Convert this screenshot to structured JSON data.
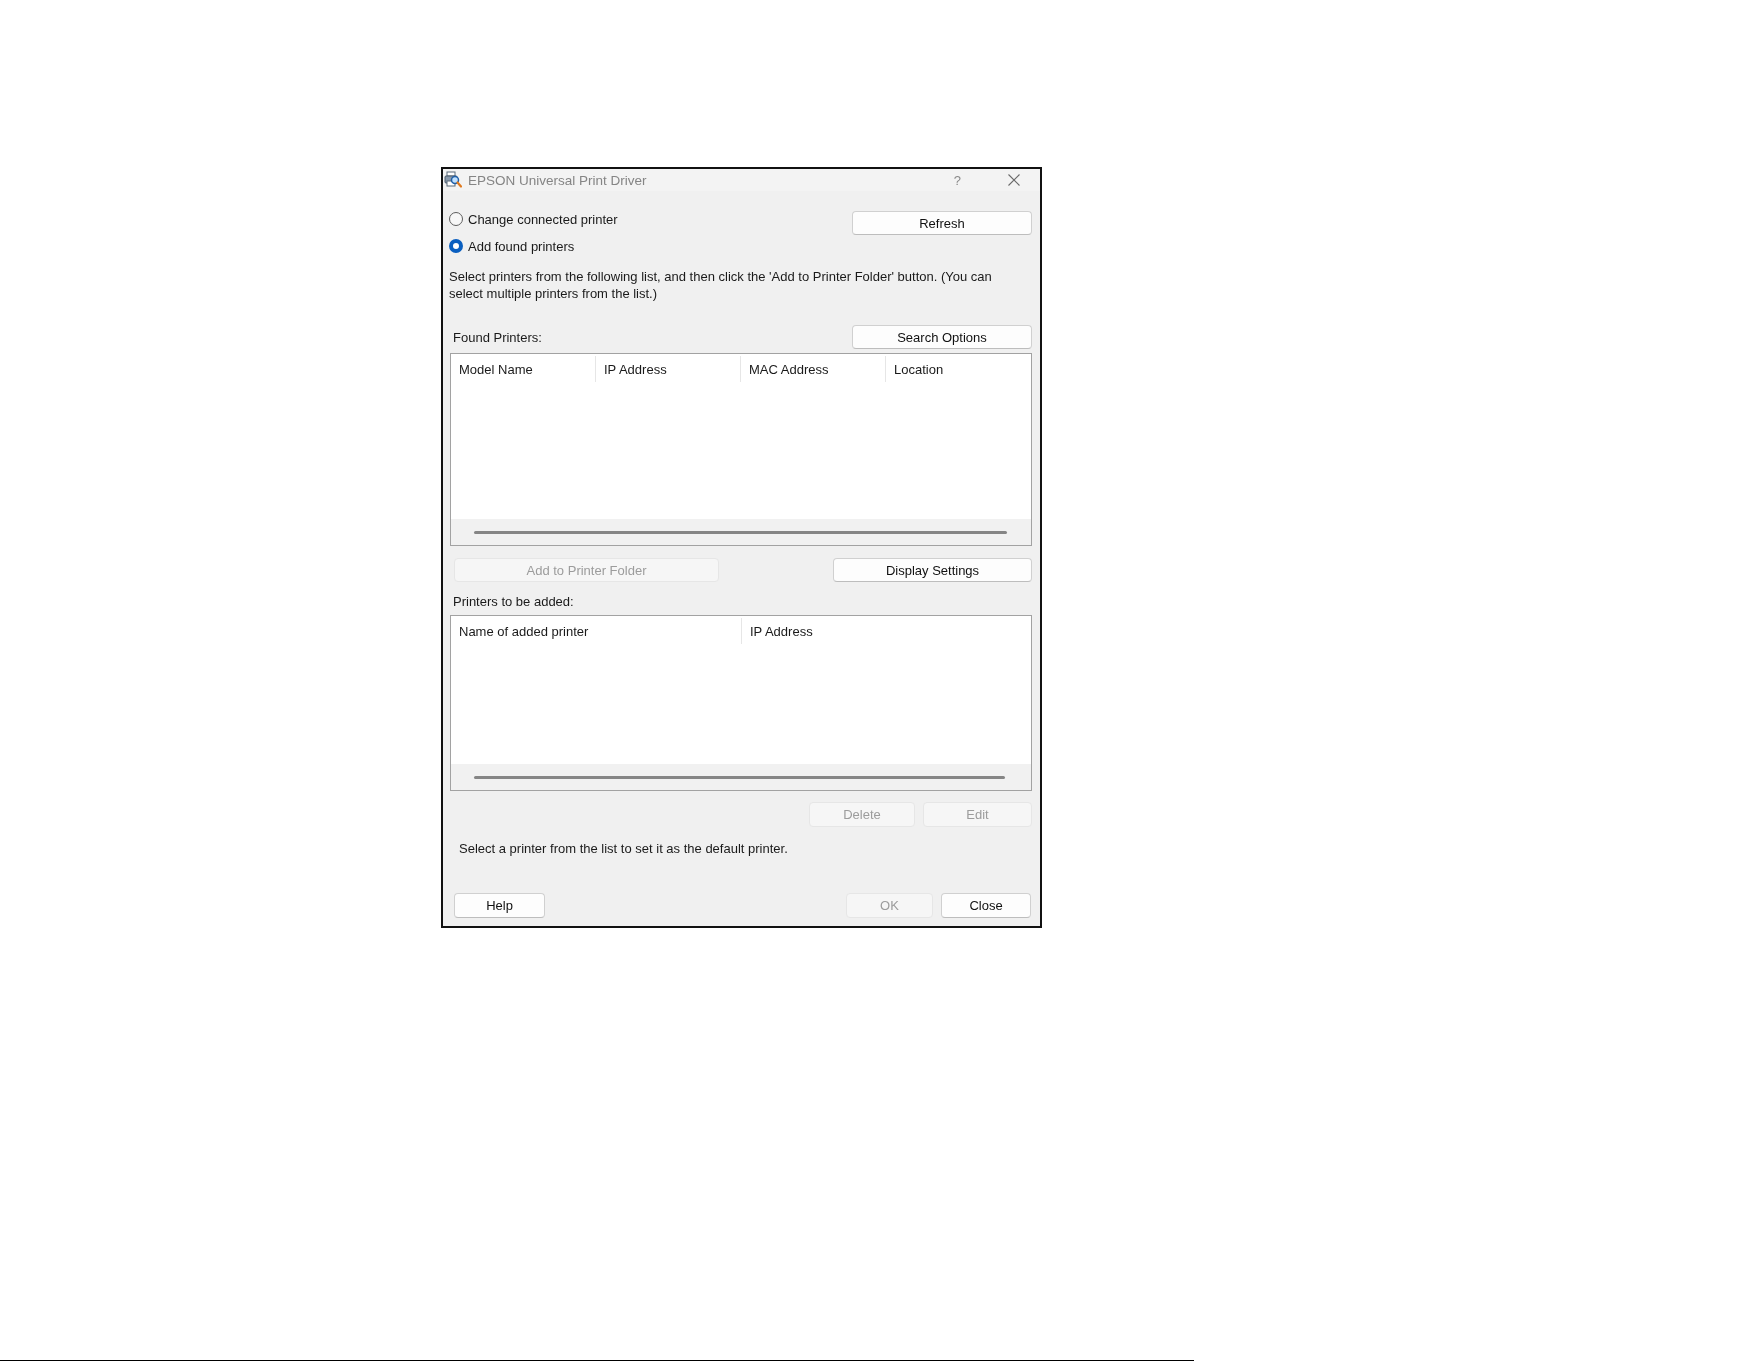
{
  "window": {
    "title": "EPSON Universal Print Driver",
    "help_label": "?"
  },
  "mode_options": [
    {
      "label": "Change connected printer",
      "selected": false
    },
    {
      "label": "Add found printers",
      "selected": true
    }
  ],
  "refresh_button": {
    "label": "Refresh",
    "disabled": false
  },
  "instructions": "Select printers from the following list, and then click the 'Add to Printer Folder' button. (You can select multiple printers from the list.)",
  "found_printers": {
    "label": "Found Printers:",
    "search_options_button": {
      "label": "Search Options",
      "disabled": false
    },
    "columns": [
      "Model Name",
      "IP Address",
      "MAC Address",
      "Location"
    ]
  },
  "add_to_folder_button": {
    "label": "Add to Printer Folder",
    "disabled": true
  },
  "display_settings_button": {
    "label": "Display Settings",
    "disabled": false
  },
  "printers_to_add": {
    "label": "Printers to be added:",
    "columns": [
      "Name of added printer",
      "IP Address"
    ]
  },
  "list_buttons": [
    {
      "label": "Delete",
      "disabled": true
    },
    {
      "label": "Edit",
      "disabled": true
    }
  ],
  "default_hint": "Select a printer from the list to set it as the default printer.",
  "footer_buttons": [
    {
      "label": "Help",
      "disabled": false
    },
    {
      "label": "OK",
      "disabled": true
    },
    {
      "label": "Close",
      "disabled": false
    }
  ]
}
